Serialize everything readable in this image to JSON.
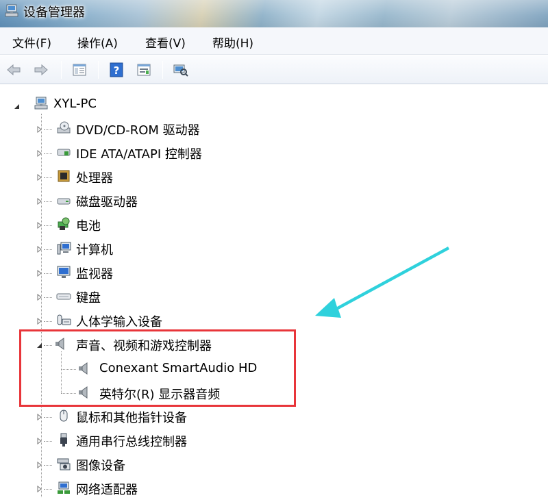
{
  "window": {
    "title": "设备管理器"
  },
  "menu": {
    "file": "文件(F)",
    "action": "操作(A)",
    "view": "查看(V)",
    "help": "帮助(H)"
  },
  "toolbar": {
    "buttons": [
      "back-icon",
      "forward-icon",
      "properties-icon",
      "help-icon",
      "update-driver-icon",
      "scan-hardware-icon"
    ]
  },
  "tree": {
    "root": "XYL-PC",
    "items": [
      {
        "label": "DVD/CD-ROM 驱动器",
        "icon": "dvd-drive-icon"
      },
      {
        "label": "IDE ATA/ATAPI 控制器",
        "icon": "ide-controller-icon"
      },
      {
        "label": "处理器",
        "icon": "processor-icon"
      },
      {
        "label": "磁盘驱动器",
        "icon": "disk-drive-icon"
      },
      {
        "label": "电池",
        "icon": "battery-icon"
      },
      {
        "label": "计算机",
        "icon": "computer-icon"
      },
      {
        "label": "监视器",
        "icon": "monitor-icon"
      },
      {
        "label": "键盘",
        "icon": "keyboard-icon"
      },
      {
        "label": "人体学输入设备",
        "icon": "hid-icon"
      },
      {
        "label": "声音、视频和游戏控制器",
        "icon": "speaker-icon",
        "expanded": true
      },
      {
        "label": "鼠标和其他指针设备",
        "icon": "mouse-icon"
      },
      {
        "label": "通用串行总线控制器",
        "icon": "usb-icon"
      },
      {
        "label": "图像设备",
        "icon": "camera-icon"
      },
      {
        "label": "网络适配器",
        "icon": "network-adapter-icon"
      }
    ],
    "sound_children": [
      {
        "label": "Conexant SmartAudio HD",
        "icon": "speaker-icon"
      },
      {
        "label": "英特尔(R) 显示器音频",
        "icon": "speaker-icon"
      }
    ]
  },
  "colors": {
    "highlight_box": "#e8353a",
    "arrow": "#2fd1dc"
  }
}
